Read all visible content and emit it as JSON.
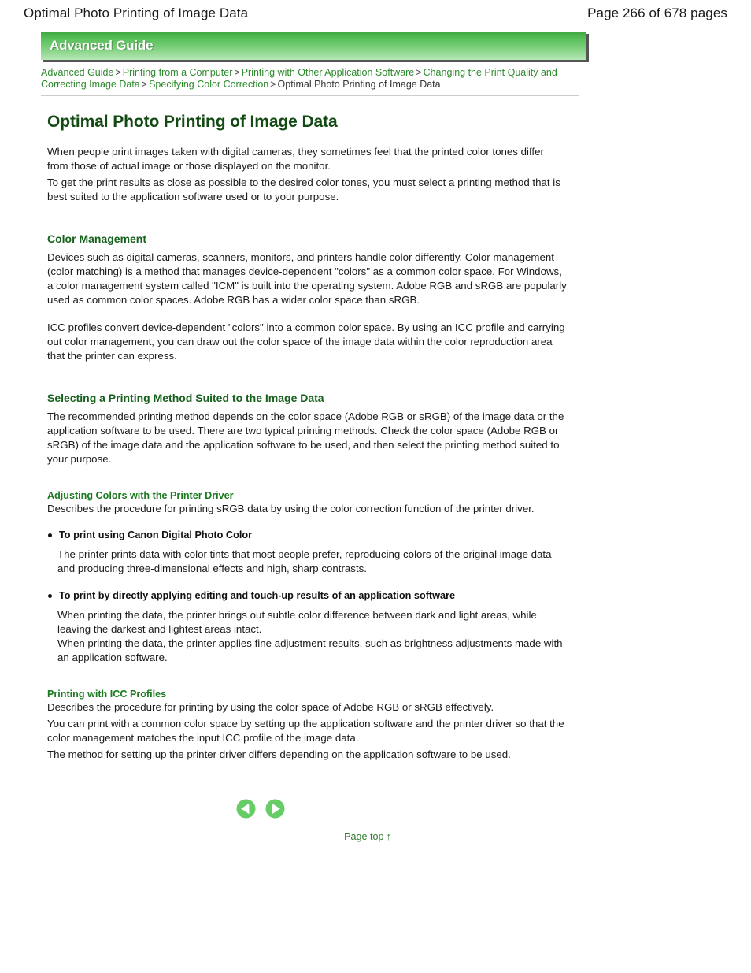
{
  "header": {
    "title": "Optimal Photo Printing of Image Data",
    "page_count": "Page 266 of 678 pages"
  },
  "banner": {
    "label": "Advanced Guide"
  },
  "breadcrumb": {
    "items": [
      {
        "label": "Advanced Guide",
        "link": true
      },
      {
        "label": "Printing from a Computer",
        "link": true
      },
      {
        "label": "Printing with Other Application Software",
        "link": true
      },
      {
        "label": "Changing the Print Quality and Correcting Image Data",
        "link": true
      },
      {
        "label": "Specifying Color Correction",
        "link": true
      },
      {
        "label": "Optimal Photo Printing of Image Data",
        "link": false
      }
    ],
    "separator": ">"
  },
  "doc": {
    "title": "Optimal Photo Printing of Image Data",
    "intro_p1": "When people print images taken with digital cameras, they sometimes feel that the printed color tones differ from those of actual image or those displayed on the monitor.",
    "intro_p2": "To get the print results as close as possible to the desired color tones, you must select a printing method that is best suited to the application software used or to your purpose.",
    "sections": {
      "color_management": {
        "heading": "Color Management",
        "p1": "Devices such as digital cameras, scanners, monitors, and printers handle color differently. Color management (color matching) is a method that manages device-dependent \"colors\" as a common color space. For Windows, a color management system called \"ICM\" is built into the operating system. Adobe RGB and sRGB are popularly used as common color spaces. Adobe RGB has a wider color space than sRGB.",
        "p2": "ICC profiles convert device-dependent \"colors\" into a common color space. By using an ICC profile and carrying out color management, you can draw out the color space of the image data within the color reproduction area that the printer can express."
      },
      "selecting_method": {
        "heading": "Selecting a Printing Method Suited to the Image Data",
        "p1": "The recommended printing method depends on the color space (Adobe RGB or sRGB) of the image data or the application software to be used. There are two typical printing methods. Check the color space (Adobe RGB or sRGB) of the image data and the application software to be used, and then select the printing method suited to your purpose."
      },
      "adjusting_colors": {
        "heading": "Adjusting Colors with the Printer Driver",
        "p1": "Describes the procedure for printing sRGB data by using the color correction function of the printer driver.",
        "bullets": [
          {
            "title": "To print using Canon Digital Photo Color",
            "body": "The printer prints data with color tints that most people prefer, reproducing colors of the original image data and producing three-dimensional effects and high, sharp contrasts."
          },
          {
            "title": "To print by directly applying editing and touch-up results of an application software",
            "body": "When printing the data, the printer brings out subtle color difference between dark and light areas, while leaving the darkest and lightest areas intact.\nWhen printing the data, the printer applies fine adjustment results, such as brightness adjustments made with an application software."
          }
        ]
      },
      "icc_profiles": {
        "heading": "Printing with ICC Profiles",
        "p1": "Describes the procedure for printing by using the color space of Adobe RGB or sRGB effectively.",
        "p2": "You can print with a common color space by setting up the application software and the printer driver so that the color management matches the input ICC profile of the image data.",
        "p3": "The method for setting up the printer driver differs depending on the application software to be used."
      }
    }
  },
  "navigation": {
    "previous_icon": "arrow-left-circle-icon",
    "next_icon": "arrow-right-circle-icon",
    "page_top_label": "Page top",
    "page_top_icon": "arrow-up-icon"
  },
  "colors": {
    "banner_green_top": "#3fa63f",
    "banner_green_bottom": "#b6e8b6",
    "title_green": "#134913",
    "section_green": "#15601a",
    "subsection_green": "#1a7a1f",
    "link_green": "#2b8a2b",
    "arrow_green": "#66cc66",
    "rule_gray": "#cccccc"
  }
}
